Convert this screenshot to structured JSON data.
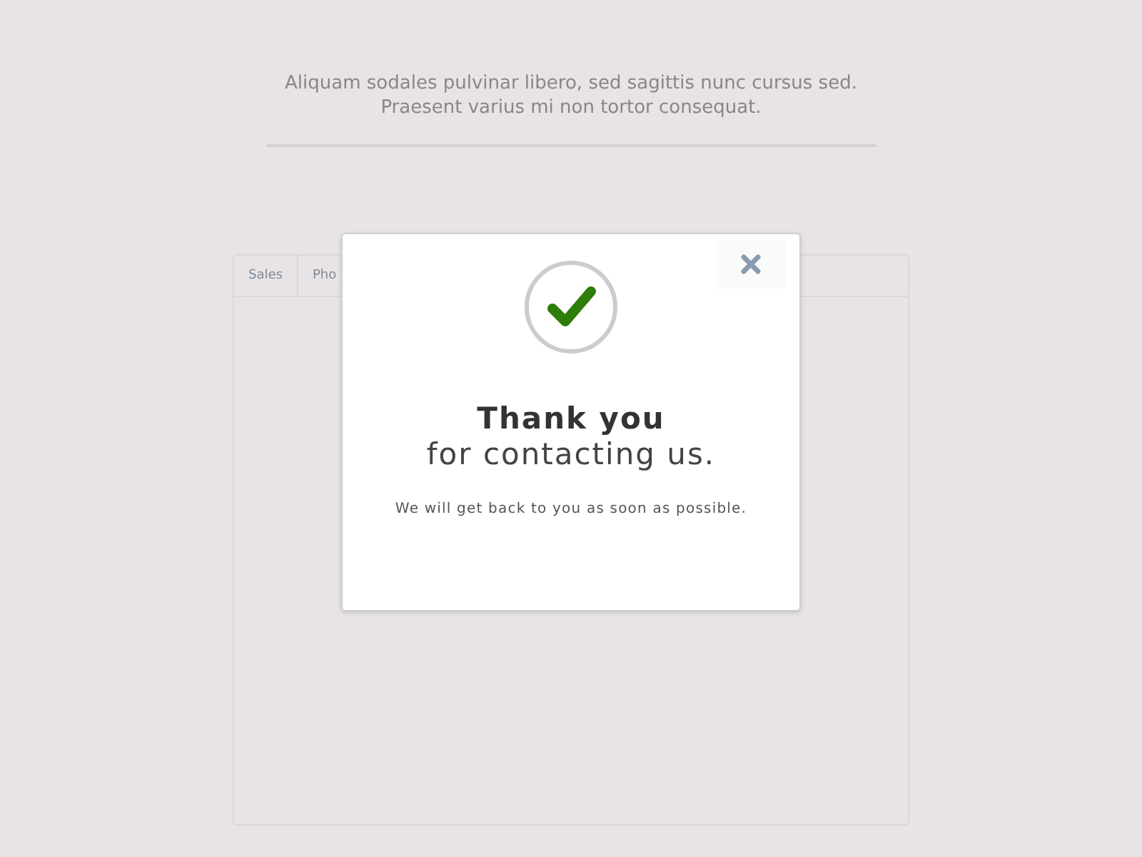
{
  "background": {
    "intro": "Aliquam sodales pulvinar libero, sed sagittis nunc cursus sed. Praesent varius mi non tortor consequat.",
    "tabs": [
      {
        "label": "Sales"
      },
      {
        "label": "Pho"
      }
    ]
  },
  "dialog": {
    "title": "Thank you",
    "subtitle": "for contacting us.",
    "message": "We will get back to you as soon as possible."
  }
}
